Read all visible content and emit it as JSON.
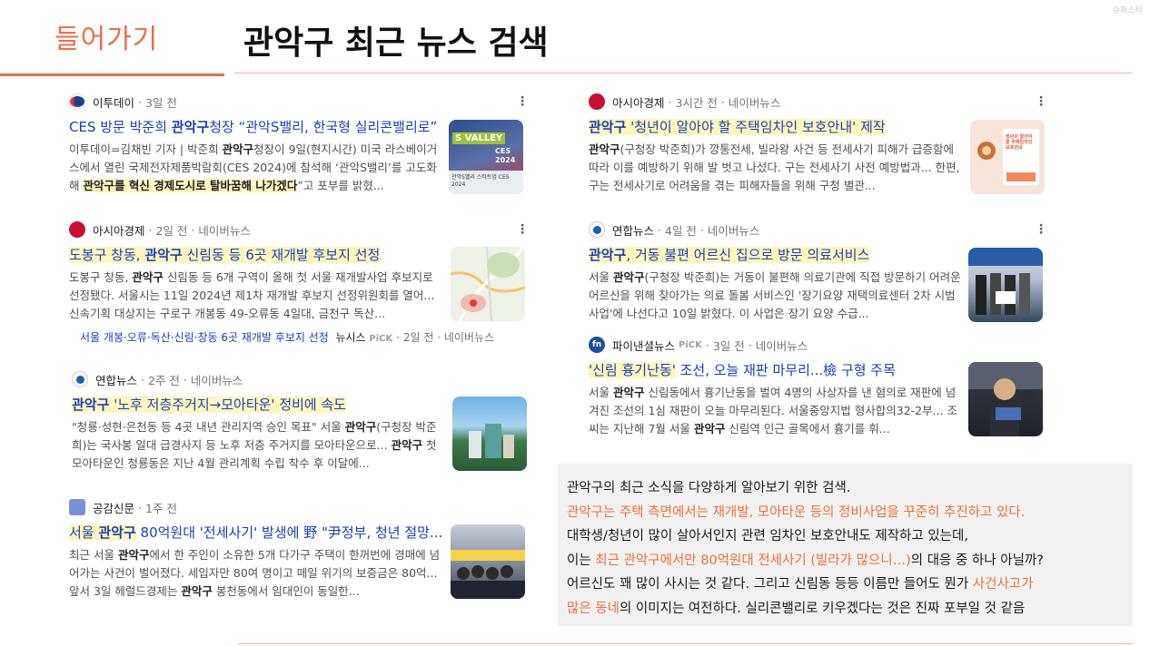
{
  "header": {
    "intro": "들어가기",
    "title": "관악구 최근 뉴스 검색",
    "watermark": "슈퍼스타"
  },
  "articles": [
    {
      "source": "이투데이",
      "time": "3일 전",
      "platform": "",
      "headline": [
        "CES 방문 박준희 ",
        "관악구",
        "청장 “관악S밸리, 한국형 실리콘밸리로”"
      ],
      "snippet": [
        "이투데이=김채빈 기자 | 박준희 ",
        "관악구",
        "청장이 9일(현지시간) 미국 라스베이거스에서 열린 국제전자제품박람회(CES 2024)에 참석해 ‘관악S밸리’를 고도화해 ",
        "관악구를 혁신 경제도시로 탈바꿈해 나가겠다",
        "”고 포부를 밝혔..."
      ]
    },
    {
      "source": "아시아경제",
      "time": "2일 전",
      "platform": "네이버뉴스",
      "headline": [
        "도봉구 창동, ",
        "관악구",
        " 신림동 등 6곳 재개발 후보지 선정"
      ],
      "snippet": [
        "도봉구 창동, ",
        "관악구",
        " 신림동 등 6개 구역이 올해 첫 서울 재개발사업 후보지로 선정됐다. 서울시는 11일 2024년 제1차 재개발 후보지 선정위원회를 열어... 신속기획 대상지는 구로구 개봉동 49-오류동 4일대, 금천구 독산..."
      ],
      "related": {
        "link": "서울 개봉·오류·독산·신림·창동 6곳 재개발 후보지 선정",
        "source": "뉴시스",
        "pick": "PiCK",
        "time": "2일 전",
        "platform": "네이버뉴스"
      }
    },
    {
      "source": "연합뉴스",
      "time": "2주 전",
      "platform": "네이버뉴스",
      "headline": [
        "관악구",
        " '노후 저층주거지→모아타운' 정비에 속도"
      ],
      "snippet": [
        "\"청룡·성현·은천동 등 4곳 내년 관리지역 승인 목표\" 서울 ",
        "관악구",
        "(구청장 박준희)는 국사봉 일대 급경사지 등 노후 저층 주거지를 모아타운으로... ",
        "관악구",
        " 첫 모아타운인 청룡동은 지난 4월 관리계획 수립 착수 후 이달에..."
      ]
    },
    {
      "source": "공감신문",
      "time": "1주 전",
      "platform": "",
      "headline": [
        "서울 ",
        "관악구",
        " 80억원대 '전세사기' 발생에 野 \"尹정부, 청년 절망..."
      ],
      "snippet": [
        "최근 서울 ",
        "관악구",
        "에서 한 주인이 소유한 5개 다가구 주택이 한꺼번에 경매에 넘어가는 사건이 벌어졌다. 세입자만 80여 명이고 떼일 위기의 보증금은 80억... 앞서 3일 헤럴드경제는 ",
        "관악구",
        " 봉천동에서 임대인이 동일한..."
      ]
    },
    {
      "source": "아시아경제",
      "time": "3시간 전",
      "platform": "네이버뉴스",
      "headline": [
        "관악구",
        " '청년이 알아야 할 주택임차인 보호안내' 제작"
      ],
      "snippet": [
        "관악구",
        "(구청장 박준희)가 깡통전세, 빌라왕 사건 등 전세사기 피해가 급증함에 따라 이를 예방하기 위해 발 벗고 나섰다. 구는 전세사기 사전 예방법과... 한편, 구는 전세사기로 어려움을 겪는 피해자들을 위해 구청 별관..."
      ]
    },
    {
      "source": "연합뉴스",
      "time": "4일 전",
      "platform": "네이버뉴스",
      "headline": [
        "관악구",
        ", 거동 불편 어르신 집으로 방문 의료서비스"
      ],
      "snippet": [
        "서울 ",
        "관악구",
        "(구청장 박준희)는 거동이 불편해 의료기관에 직접 방문하기 어려운 어르신을 위해 찾아가는 의료 돌봄 서비스인 '장기요양 재택의료센터 2차 시범사업'에 나선다고 10일 밝혔다. 이 사업은 장기 요양 수급..."
      ]
    },
    {
      "source": "파이낸셜뉴스",
      "pick": "PiCK",
      "time": "3일 전",
      "platform": "네이버뉴스",
      "headline": [
        "'신림 흉기난동'",
        " 조선, 오늘 재판 마무리...檢 구형 주목"
      ],
      "snippet": [
        "서울 ",
        "관악구",
        " 신림동에서 흉기난동을 벌여 4명의 사상자를 낸 혐의로 재판에 넘겨진 조선의 1심 재판이 오늘 마무리된다. 서울중앙지법 형사합의32-2부... 조씨는 지난해 7월 서울 ",
        "관악구",
        " 신림역 인근 골목에서 흉기를 휘..."
      ]
    }
  ],
  "thumbs": {
    "t1_sign": "S VALLEY",
    "t1_side": "CES 2024",
    "t1_caption": "관악S밸리 스타트업 CES 2024",
    "t5_title": "청년이 알아야 할 주택임차인 보호안내"
  },
  "note": {
    "line1": "관악구의 최근 소식을 다양하게 알아보기 위한 검색.",
    "line2": "관악구는 주택 측면에서는 재개발, 모아타운 등의 정비사업을 꾸준히 추진하고 있다.",
    "line3": "대학생/청년이 많이 살아서인지  관련 임차인 보호안내도 제작하고 있는데,",
    "line4a": "이는 ",
    "line4b": "최근 관악구에서만 80억원대 전세사기 (빌라가 많으니…)",
    "line4c": "의 대응 중 하나 아닐까?",
    "line5a": "어르신도 꽤 많이 사시는 것 같다.  그리고 신림동 등등 이름만 들어도 뭔가 ",
    "line5b": "사건사고가",
    "line6a": "많은 동네",
    "line6b": "의 이미지는 여전하다. 실리콘밸리로 키우겠다는 것은 진짜 포부일 것 같음"
  },
  "colors": {
    "accent": "#ec6f4a",
    "link": "#1a3fb8",
    "highlight": "#fff6bf",
    "note_bg": "#f1f1f1"
  }
}
